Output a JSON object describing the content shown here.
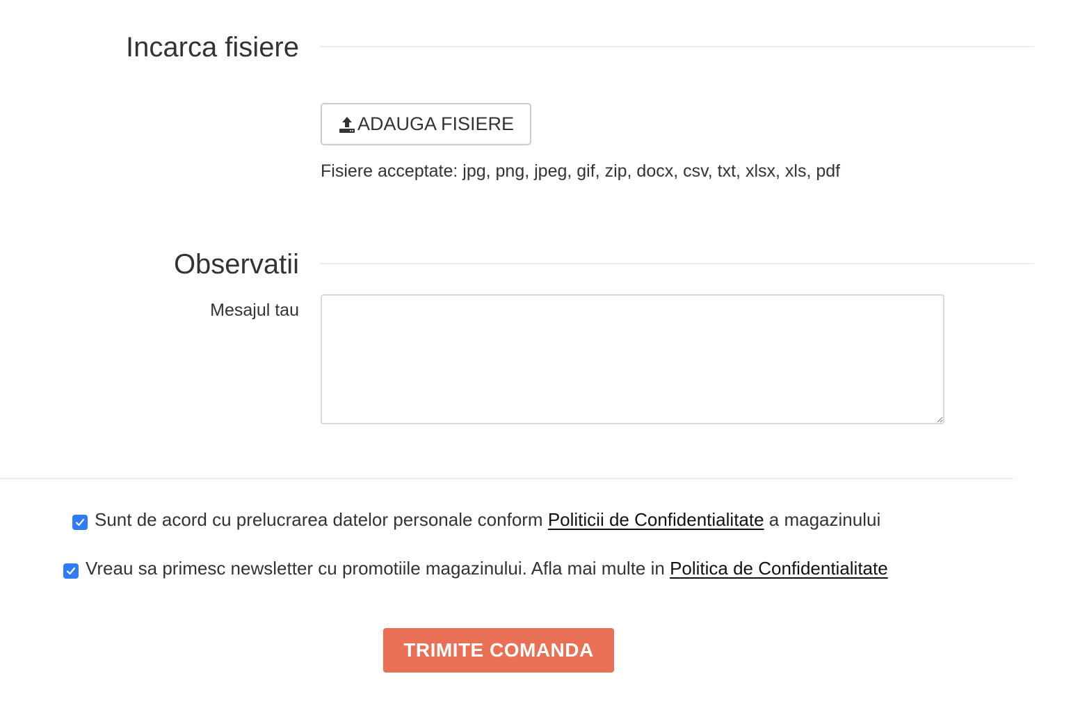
{
  "upload_section": {
    "title": "Incarca fisiere",
    "button_label": "ADAUGA FISIERE",
    "button_icon": "upload-icon",
    "accepted_text": "Fisiere acceptate: jpg, png, jpeg, gif, zip, docx, csv, txt, xlsx, xls, pdf"
  },
  "notes_section": {
    "title": "Observatii",
    "message_label": "Mesajul tau",
    "message_value": ""
  },
  "consents": [
    {
      "checked": true,
      "text_before": "Sunt de acord cu prelucrarea datelor personale conform ",
      "link_text": "Politicii de Confidentialitate",
      "text_after": " a magazinului"
    },
    {
      "checked": true,
      "text_before": "Vreau sa primesc newsletter cu promotiile magazinului. Afla mai multe in ",
      "link_text": "Politica de Confidentialitate",
      "text_after": ""
    }
  ],
  "submit": {
    "label": "TRIMITE COMANDA"
  },
  "colors": {
    "accent": "#e96f55",
    "checkbox": "#2f7cf6",
    "text": "#333333",
    "line": "#ececec"
  }
}
